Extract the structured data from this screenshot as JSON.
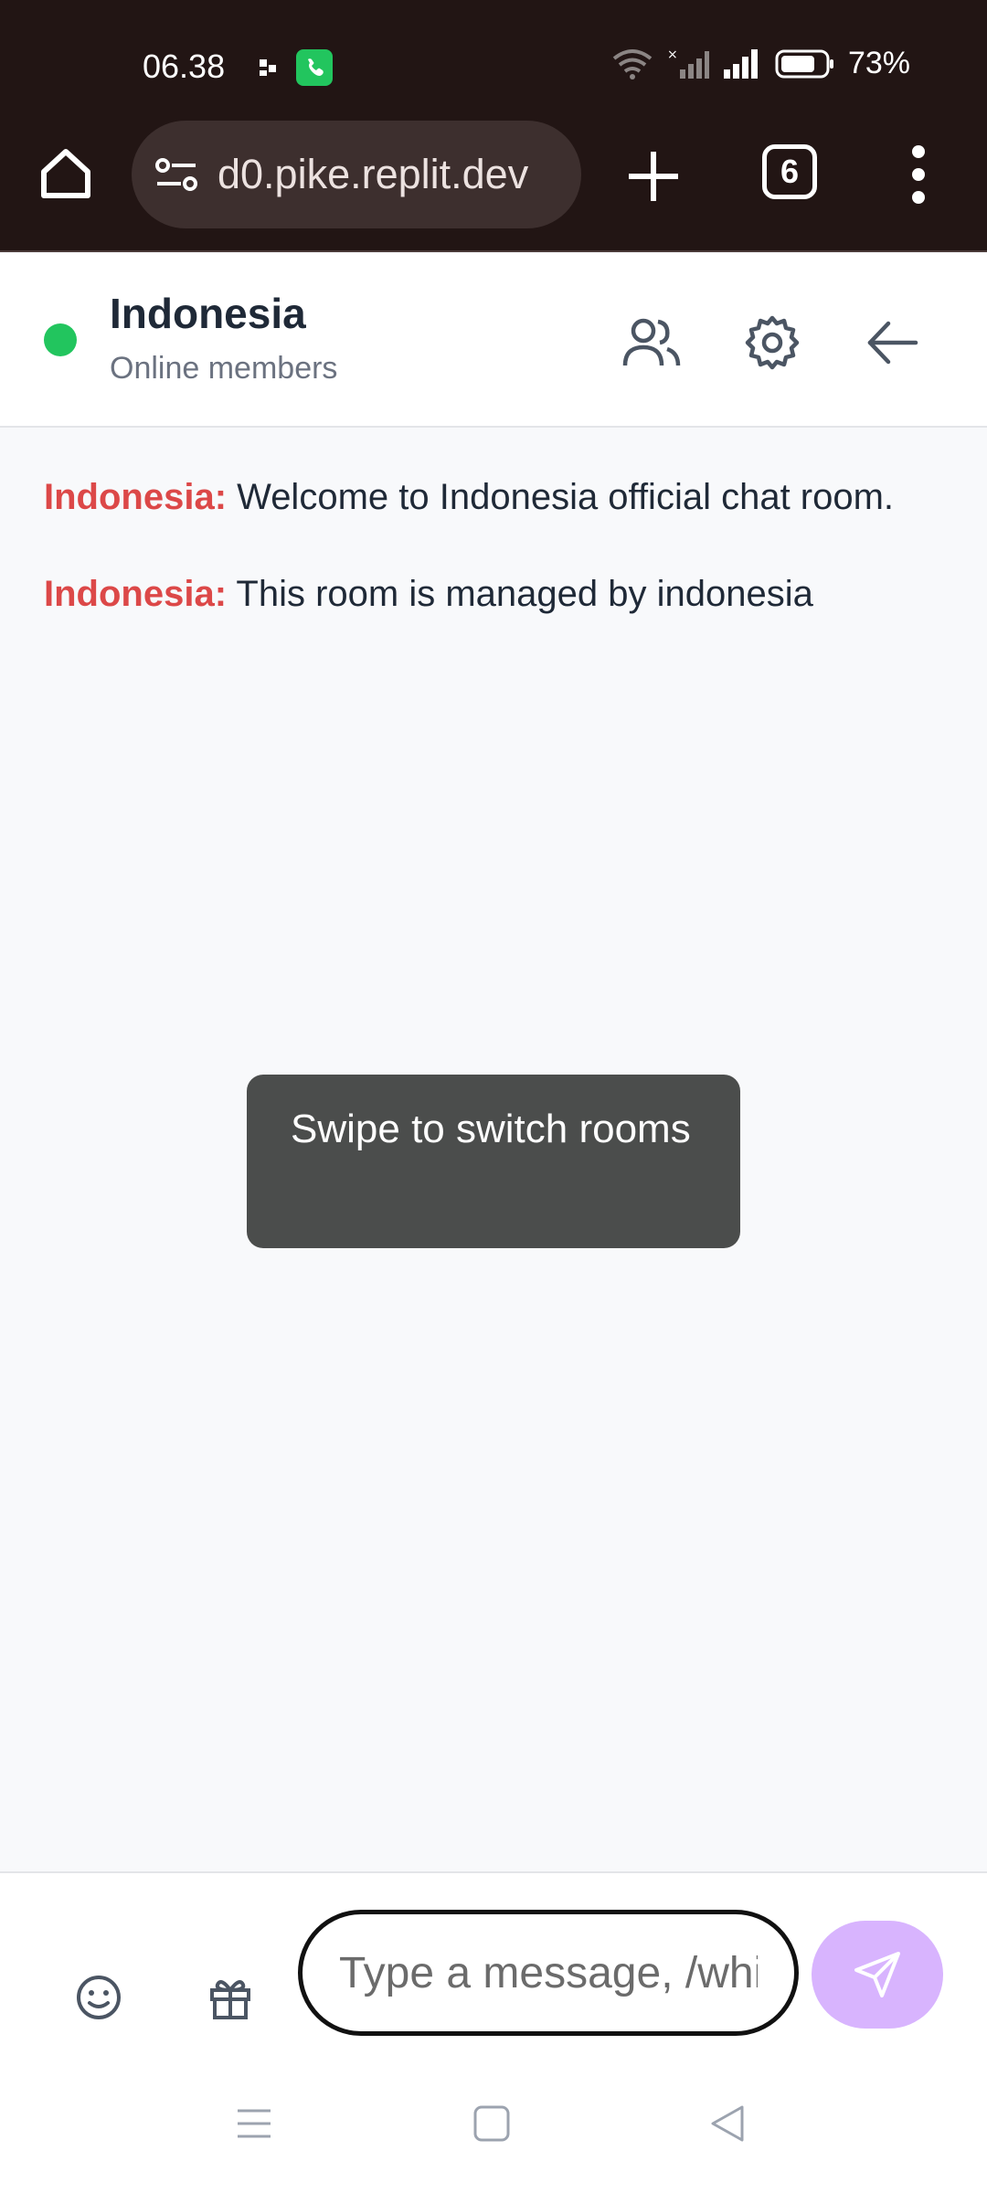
{
  "status_bar": {
    "time": "06.38",
    "battery_percent": "73%",
    "icons": [
      "notification-dot-icon",
      "phone-call-icon",
      "wifi-icon",
      "no-signal-icon",
      "signal-icon",
      "battery-icon"
    ]
  },
  "browser": {
    "url": "d0.pike.replit.dev",
    "tab_count": "6",
    "icons": [
      "home-icon",
      "site-settings-icon",
      "new-tab-icon",
      "more-menu-icon"
    ]
  },
  "room": {
    "title": "Indonesia",
    "subtitle": "Online members",
    "status_color": "#22c55e",
    "header_icons": [
      "members-icon",
      "settings-gear-icon",
      "back-arrow-icon"
    ]
  },
  "messages": [
    {
      "sender": "Indonesia:",
      "text": "Welcome to Indonesia official chat room."
    },
    {
      "sender": "Indonesia:",
      "text": "This room is managed by indonesia"
    }
  ],
  "toast": {
    "text": "Swipe to switch rooms"
  },
  "composer": {
    "placeholder": "Type a message, /whisper...",
    "icons": [
      "emoji-icon",
      "gift-icon",
      "send-icon"
    ],
    "send_color": "#d8b4fe"
  },
  "colors": {
    "sender": "#dc4848",
    "browser_bg": "#221514"
  },
  "nav_bar": {
    "icons": [
      "recent-apps-icon",
      "home-nav-icon",
      "back-nav-icon"
    ]
  }
}
